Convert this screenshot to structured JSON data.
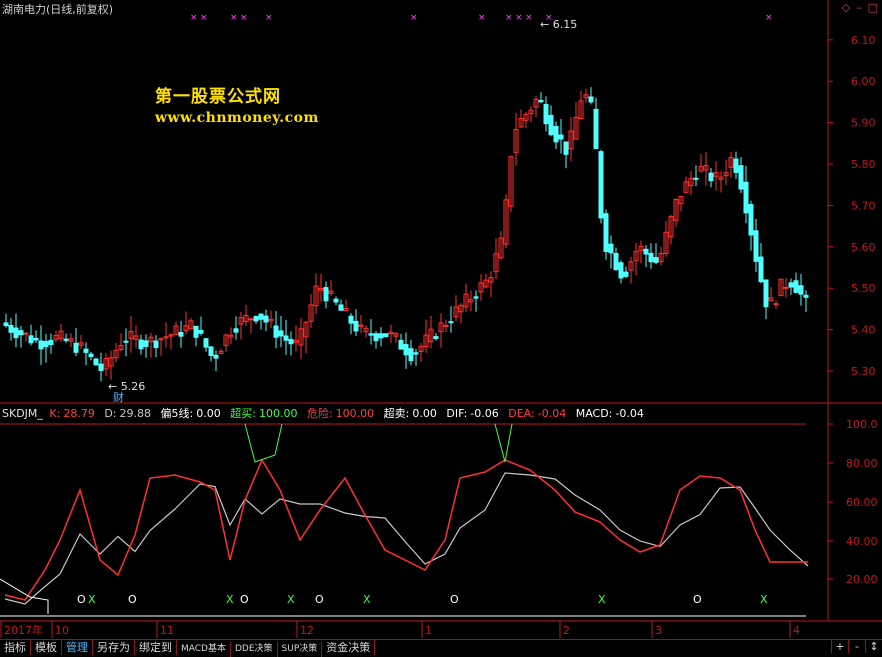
{
  "header": {
    "title": "湖南电力(日线,前复权)",
    "corner_icons": [
      "diamond-icon",
      "minimize-icon",
      "close-icon"
    ]
  },
  "watermark": {
    "line1": "第一股票公式网",
    "line2": "www.chnmoney.com"
  },
  "main_chart": {
    "price_axis": [
      "6.10",
      "6.00",
      "5.90",
      "5.80",
      "5.70",
      "5.60",
      "5.50",
      "5.40",
      "5.30"
    ],
    "price_range": [
      5.23,
      6.16
    ],
    "high_marker": "6.15",
    "low_marker": "5.26",
    "fin_marker": "财",
    "colors": {
      "up": "#ff3030",
      "down": "#50ffff",
      "axis": "#c01818",
      "marker": "#ff40ff"
    }
  },
  "indicator": {
    "name": "SKDJM_",
    "items": [
      {
        "label": "K:",
        "value": "28.79",
        "color": "#ff4040"
      },
      {
        "label": "D:",
        "value": "29.88",
        "color": "#c8c8c8"
      },
      {
        "label": "偏5线:",
        "value": "0.00",
        "color": "#ffffff"
      },
      {
        "label": "超买:",
        "value": "100.00",
        "color": "#40ff40"
      },
      {
        "label": "危险:",
        "value": "100.00",
        "color": "#ff4040"
      },
      {
        "label": "超卖:",
        "value": "0.00",
        "color": "#ffffff"
      },
      {
        "label": "DIF:",
        "value": "-0.06",
        "color": "#ffffff"
      },
      {
        "label": "DEA:",
        "value": "-0.04",
        "color": "#ff4040"
      },
      {
        "label": "MACD:",
        "value": "-0.04",
        "color": "#ffffff"
      }
    ],
    "axis": [
      "100.0",
      "80.00",
      "60.00",
      "40.00",
      "20.00"
    ]
  },
  "date_axis": [
    "2017年",
    "10",
    "11",
    "12",
    "1",
    "2",
    "3",
    "4"
  ],
  "toolbar": {
    "buttons": [
      "指标",
      "模板",
      "管理",
      "另存为",
      "绑定到",
      "MACD基本",
      "DDE决策",
      "SUP决策",
      "资金决策"
    ],
    "active": "管理",
    "nav": [
      "+",
      "-",
      "↕"
    ]
  }
}
